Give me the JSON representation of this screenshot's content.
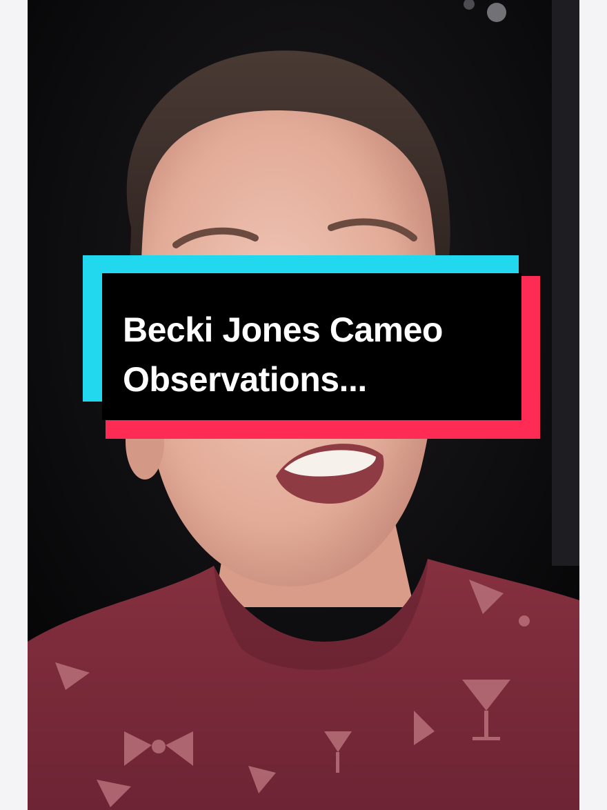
{
  "overlay": {
    "title_line1": "Becki Jones Cameo",
    "title_line2": "Observations..."
  },
  "colors": {
    "page_background": "#f4f3f6",
    "video_background": "#0b0b0d",
    "sticker_cyan": "#22d8ee",
    "sticker_pink": "#fe2c55",
    "sticker_black": "#000000",
    "title_text": "#ffffff",
    "shirt": "#7a2a3c",
    "shirt_print": "#b8707a"
  }
}
